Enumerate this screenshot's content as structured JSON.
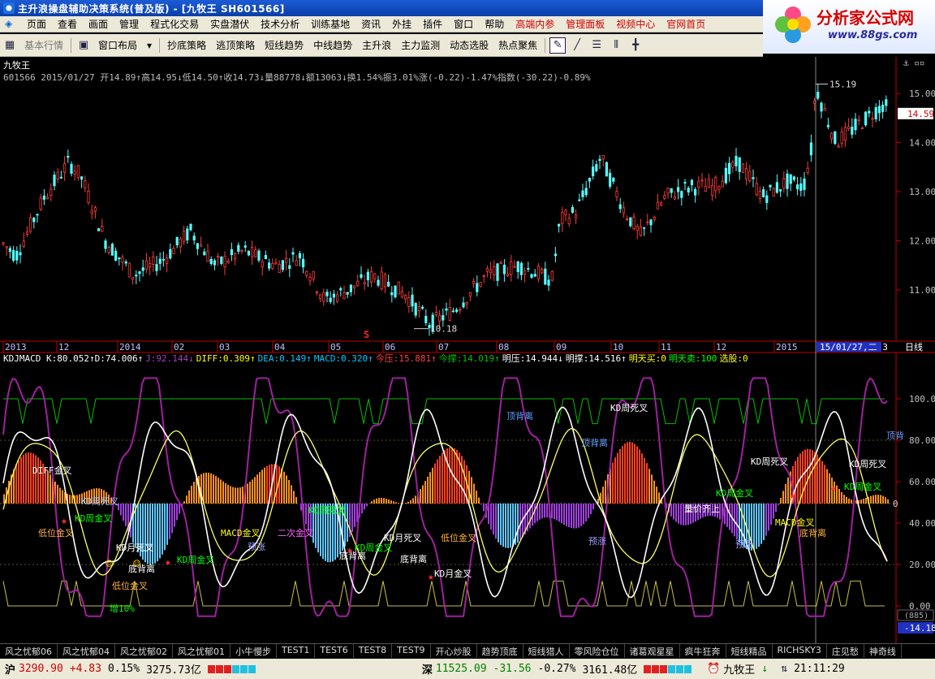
{
  "window": {
    "title": "主升浪操盘辅助决策系统(普及版) - [九牧王  SH601566]"
  },
  "menu": {
    "items": [
      "页面",
      "查看",
      "画面",
      "管理",
      "程式化交易",
      "实盘潜伏",
      "技术分析",
      "训练基地",
      "资讯",
      "外挂",
      "插件",
      "窗口",
      "帮助"
    ],
    "red_items": [
      "高端内参",
      "管理面板",
      "视频中心",
      "官网首页"
    ]
  },
  "ad": {
    "brand": "分析家公式网",
    "url": "www.88gs.com"
  },
  "toolbar": {
    "basic_quote": "基本行情",
    "window_layout": "窗口布局",
    "buttons": [
      "抄底策略",
      "逃顶策略",
      "短线趋势",
      "中线趋势",
      "主升浪",
      "主力监测",
      "动态选股",
      "热点聚焦"
    ]
  },
  "price_panel": {
    "stock_name": "九牧王",
    "info_line": "601566 2015/01/27 开14.89↑高14.95↓低14.50↑收14.73↓量88778↓额13063↓换1.54%振3.01%涨(-0.22)-1.47%指数(-30.22)-0.89%",
    "y_ticks": [
      "15.00",
      "14.00",
      "13.00",
      "12.00",
      "11.00"
    ],
    "current_price": "14.59",
    "high_label": "15.19",
    "low_label": "10.18",
    "time_axis": [
      "2013",
      "12",
      "2014",
      "02",
      "03",
      "04",
      "05",
      "06",
      "07",
      "08",
      "09",
      "10",
      "11",
      "12",
      "2015",
      "15/01/27,二 3"
    ],
    "period": "日线",
    "signal_mark": "S"
  },
  "indicator_panel": {
    "header": [
      {
        "t": "KDJMACD K:80.052↑D:74.006↑",
        "c": "#ffffff"
      },
      {
        "t": "J:92.144↓",
        "c": "#a040c0"
      },
      {
        "t": "DIFF:0.309↑",
        "c": "#ffff00"
      },
      {
        "t": "DEA:0.149↑",
        "c": "#00c8ff"
      },
      {
        "t": "MACD:0.320↑",
        "c": "#00c8ff"
      },
      {
        "t": "今压:15.881↑",
        "c": "#ff4040"
      },
      {
        "t": "今撑:14.019↑",
        "c": "#00c000"
      },
      {
        "t": "明压:14.944↓",
        "c": "#ffffff"
      },
      {
        "t": "明撑:14.516↑",
        "c": "#ffffff"
      },
      {
        "t": "明天买:0",
        "c": "#ffff00"
      },
      {
        "t": "明天卖:100",
        "c": "#00ff00"
      },
      {
        "t": "选股:0",
        "c": "#ffff00"
      }
    ],
    "y_ticks": [
      "100.00",
      "80.00",
      "60.00",
      "40.00",
      "20.00",
      "0.00"
    ],
    "zero_label": "0",
    "bottom_box": "(885)",
    "bottom_value": "-14.18",
    "annotations": [
      {
        "t": "DIFF金叉",
        "c": "#ffffff"
      },
      {
        "t": "KD周死叉",
        "c": "#a0c0ff"
      },
      {
        "t": "低位金叉",
        "c": "#ffb040"
      },
      {
        "t": "KD周金叉",
        "c": "#00ff00"
      },
      {
        "t": "KD月死叉",
        "c": "#ffffff"
      },
      {
        "t": "底背离",
        "c": "#ffffff"
      },
      {
        "t": "低位金叉",
        "c": "#ffb040"
      },
      {
        "t": "KD周金叉",
        "c": "#00ff00"
      },
      {
        "t": "MACD金叉",
        "c": "#ffff00"
      },
      {
        "t": "二次金叉",
        "c": "#ff66ff"
      },
      {
        "t": "预涨",
        "c": "#a0a0ff"
      },
      {
        "t": "KD周死叉",
        "c": "#00ff00"
      },
      {
        "t": "底背离",
        "c": "#ffffff"
      },
      {
        "t": "KD周金叉",
        "c": "#00ff00"
      },
      {
        "t": "KD月死叉",
        "c": "#ffffff"
      },
      {
        "t": "底背离",
        "c": "#ffffff"
      },
      {
        "t": "KD月金叉",
        "c": "#ffffff"
      },
      {
        "t": "低位金叉",
        "c": "#ffb040"
      },
      {
        "t": "顶背离",
        "c": "#60a0ff"
      },
      {
        "t": "KD周死叉",
        "c": "#ffffff"
      },
      {
        "t": "预涨",
        "c": "#a0a0ff"
      },
      {
        "t": "顶背离",
        "c": "#60a0ff"
      },
      {
        "t": "量价齐上",
        "c": "#ffffff"
      },
      {
        "t": "KD周死叉",
        "c": "#ffffff"
      },
      {
        "t": "KD周金叉",
        "c": "#00ff00"
      },
      {
        "t": "预涨",
        "c": "#a0a0ff"
      },
      {
        "t": "MACD金叉",
        "c": "#ffff00"
      },
      {
        "t": "底背离",
        "c": "#ffb040"
      },
      {
        "t": "KD周死叉",
        "c": "#ffffff"
      },
      {
        "t": "KD周金叉",
        "c": "#00ff00"
      },
      {
        "t": "顶背",
        "c": "#60a0ff"
      },
      {
        "t": "增10%",
        "c": "#00ff00"
      }
    ]
  },
  "bottom_tabs": [
    "风之忧郁06",
    "风之忧郁04",
    "风之忧郁02",
    "风之忧郁01",
    "小牛慢步",
    "TEST1",
    "TEST6",
    "TEST8",
    "TEST9",
    "开心炒股",
    "趋势顶底",
    "短线猎人",
    "零风险仓位",
    "诸葛观星星",
    "疯牛狂奔",
    "短线精品",
    "RICHSKY3",
    "庄见愁",
    "神奇线"
  ],
  "status": {
    "sh_label": "沪",
    "sh_index": "3290.90",
    "sh_change": "+4.83",
    "sh_pct": "0.15%",
    "sh_amount": "3275.73亿",
    "sz_label": "深",
    "sz_index": "11525.09",
    "sz_change": "-31.56",
    "sz_pct": "-0.27%",
    "sz_amount": "3161.48亿",
    "stock": "九牧王",
    "time": "21:11:29"
  },
  "colors": {
    "up_candle": "#ff3a3a",
    "down_candle": "#54ffff",
    "k_line": "#ffffff",
    "d_line": "#ffff60",
    "j_line": "#a020a0",
    "green_line": "#00c000"
  }
}
